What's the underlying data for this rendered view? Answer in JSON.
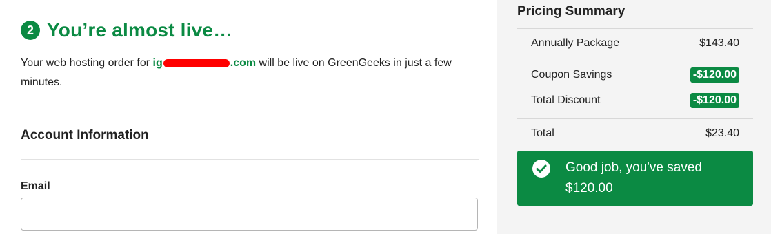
{
  "header": {
    "step_number": "2",
    "title": "You’re almost live…"
  },
  "intro": {
    "text_before": "Your web hosting order for ",
    "domain_start": "ig",
    "domain_end": ".com",
    "text_after": " will be live on GreenGeeks in just a few minutes."
  },
  "account": {
    "section_title": "Account Information",
    "email_label": "Email",
    "email_value": ""
  },
  "pricing": {
    "title": "Pricing Summary",
    "annual_label": "Annually Package",
    "annual_value": "$143.40",
    "coupon_label": "Coupon Savings",
    "coupon_value": "-$120.00",
    "discount_label": "Total Discount",
    "discount_value": "-$120.00",
    "total_label": "Total",
    "total_value": "$23.40"
  },
  "savings": {
    "message": "Good job, you've saved $120.00"
  },
  "colors": {
    "brand_green": "#0b8a43",
    "redaction": "#ff0000",
    "sidebar_bg": "#f4f4f4"
  }
}
